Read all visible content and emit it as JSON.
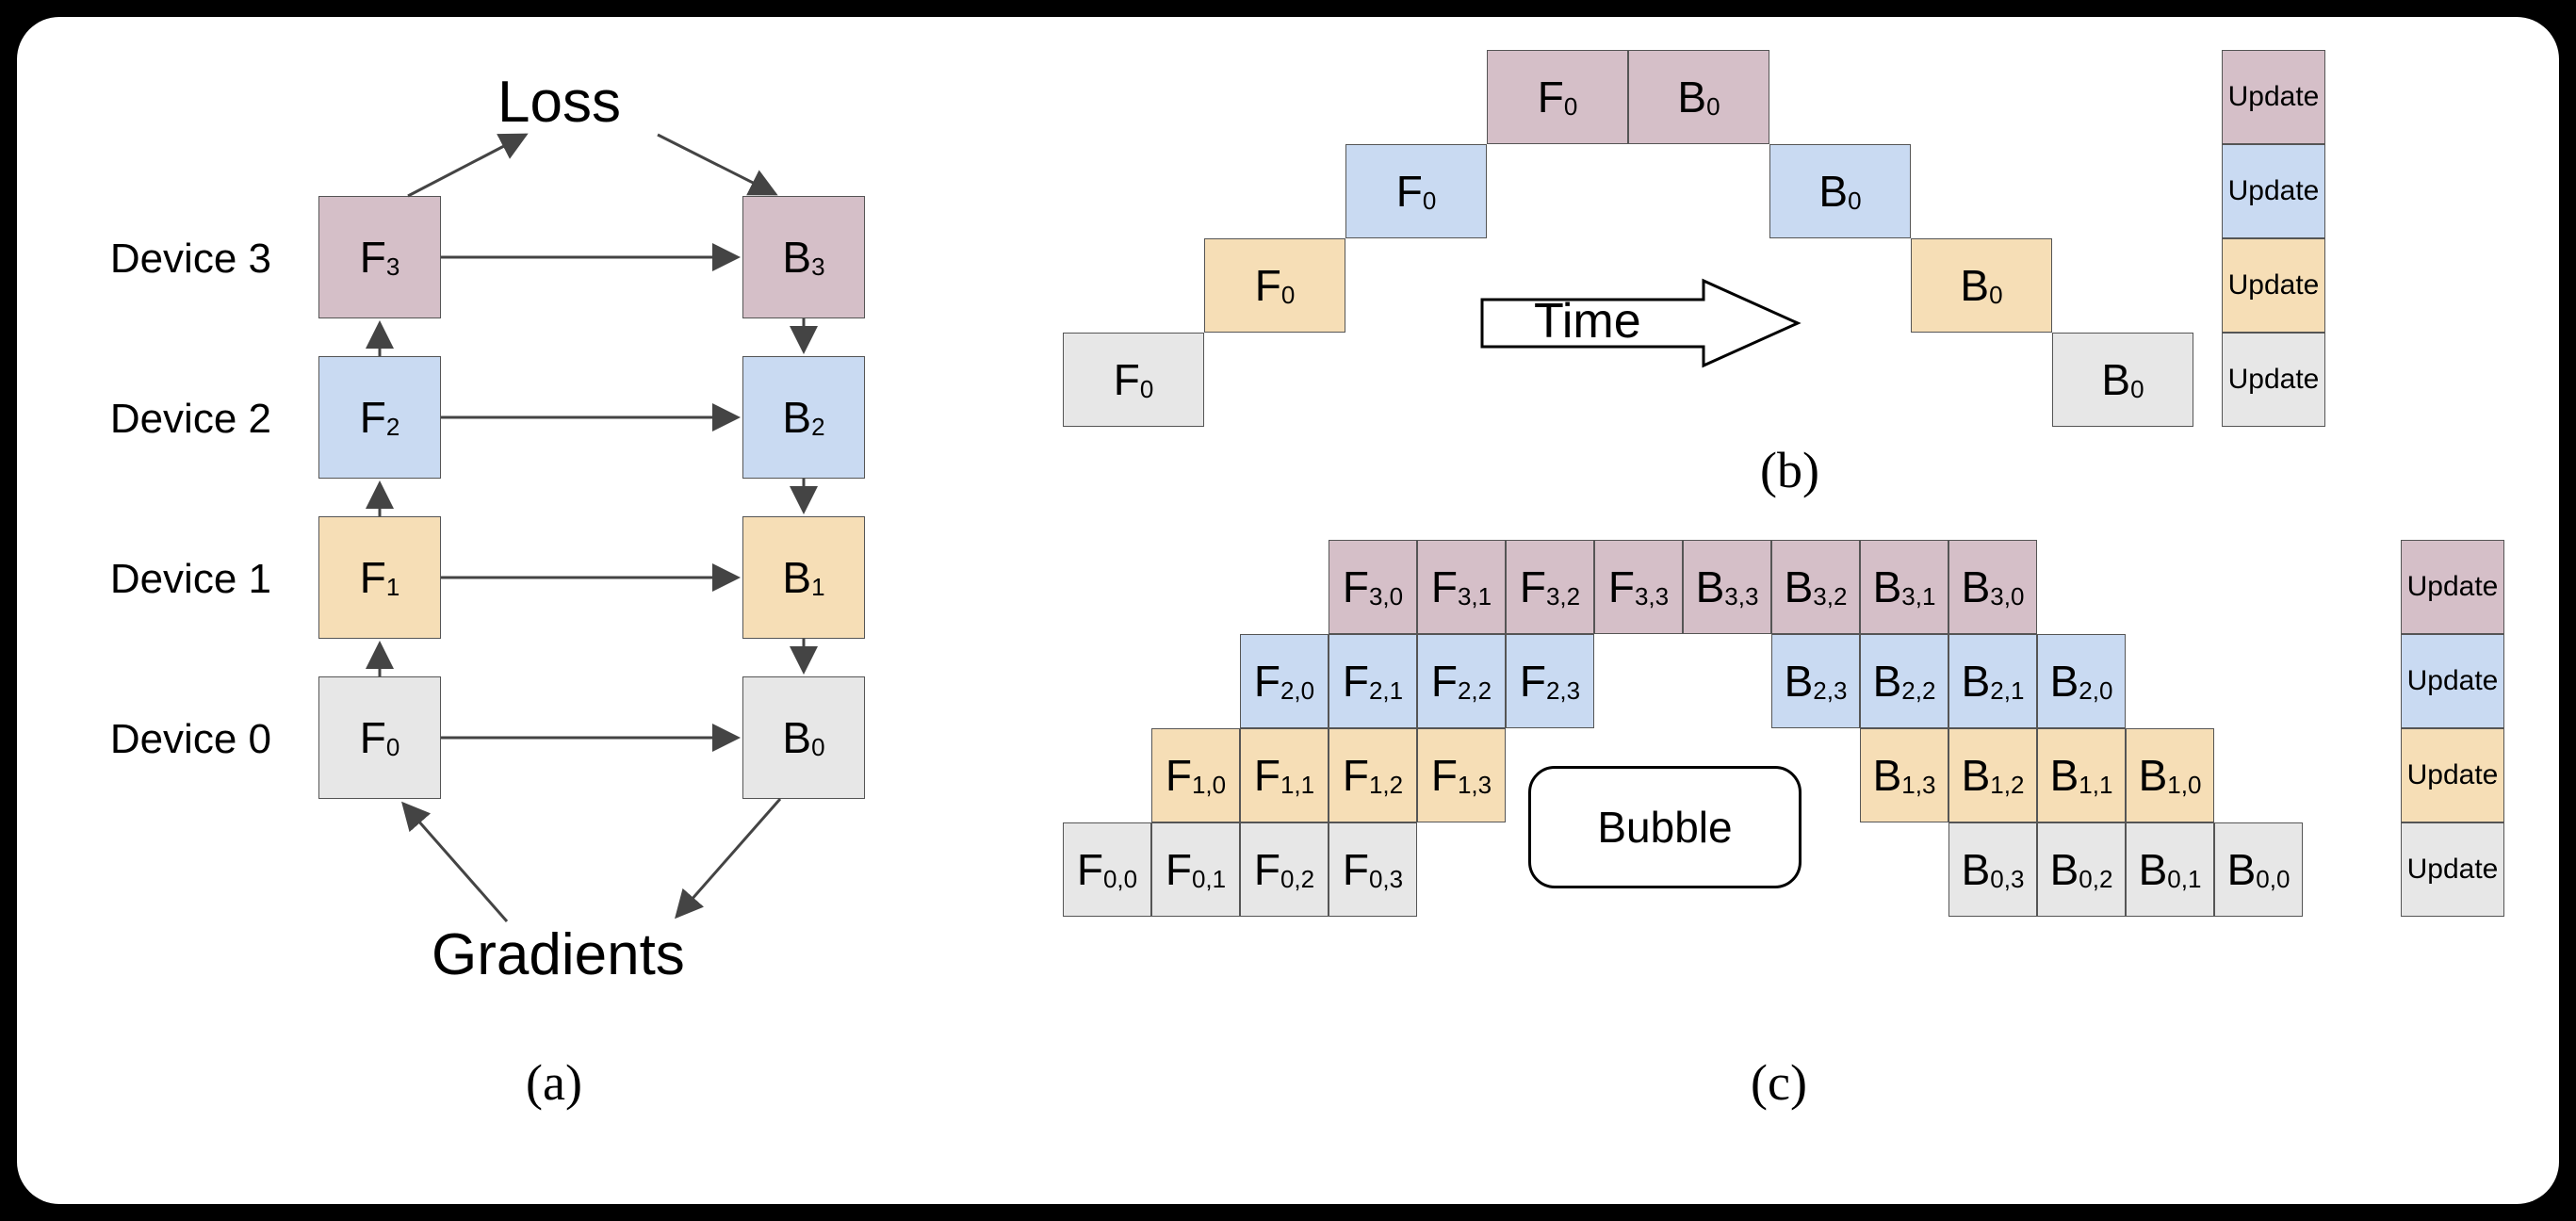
{
  "panelA": {
    "title_top": "Loss",
    "title_bottom": "Gradients",
    "caption": "(a)",
    "devices": [
      "Device 3",
      "Device 2",
      "Device 1",
      "Device 0"
    ],
    "left_boxes": [
      "F₃",
      "F₂",
      "F₁",
      "F₀"
    ],
    "right_boxes": [
      "B₃",
      "B₂",
      "B₁",
      "B₀"
    ],
    "left_raw": [
      {
        "m": "F",
        "s": "3"
      },
      {
        "m": "F",
        "s": "2"
      },
      {
        "m": "F",
        "s": "1"
      },
      {
        "m": "F",
        "s": "0"
      }
    ],
    "right_raw": [
      {
        "m": "B",
        "s": "3"
      },
      {
        "m": "B",
        "s": "2"
      },
      {
        "m": "B",
        "s": "1"
      },
      {
        "m": "B",
        "s": "0"
      }
    ],
    "colors_top_to_bottom": [
      "c3",
      "c2",
      "c1",
      "c0"
    ]
  },
  "panelB": {
    "caption": "(b)",
    "time_label": "Time",
    "update_label": "Update",
    "rows": [
      {
        "color": "c3",
        "forward": {
          "m": "F",
          "s": "0"
        },
        "backward": {
          "m": "B",
          "s": "0"
        }
      },
      {
        "color": "c2",
        "forward": {
          "m": "F",
          "s": "0"
        },
        "backward": {
          "m": "B",
          "s": "0"
        }
      },
      {
        "color": "c1",
        "forward": {
          "m": "F",
          "s": "0"
        },
        "backward": {
          "m": "B",
          "s": "0"
        }
      },
      {
        "color": "c0",
        "forward": {
          "m": "F",
          "s": "0"
        },
        "backward": {
          "m": "B",
          "s": "0"
        }
      }
    ]
  },
  "panelC": {
    "caption": "(c)",
    "bubble_label": "Bubble",
    "update_label": "Update",
    "rows": [
      {
        "color": "c3",
        "f_start": 3,
        "d": 3
      },
      {
        "color": "c2",
        "f_start": 2,
        "d": 2
      },
      {
        "color": "c1",
        "f_start": 1,
        "d": 1
      },
      {
        "color": "c0",
        "f_start": 0,
        "d": 0
      }
    ]
  }
}
